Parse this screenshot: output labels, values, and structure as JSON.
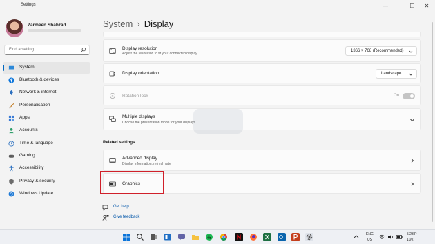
{
  "window": {
    "app_title": "Settings",
    "minimize": "—",
    "maximize": "☐",
    "close": "✕"
  },
  "user": {
    "name": "Zarmeen Shahzad"
  },
  "search": {
    "placeholder": "Find a setting"
  },
  "sidebar": {
    "items": [
      {
        "label": "System",
        "icon": "laptop-icon",
        "active": true
      },
      {
        "label": "Bluetooth & devices",
        "icon": "bluetooth-icon"
      },
      {
        "label": "Network & internet",
        "icon": "network-icon"
      },
      {
        "label": "Personalisation",
        "icon": "brush-icon"
      },
      {
        "label": "Apps",
        "icon": "apps-icon"
      },
      {
        "label": "Accounts",
        "icon": "person-icon"
      },
      {
        "label": "Time & language",
        "icon": "globe-clock-icon"
      },
      {
        "label": "Gaming",
        "icon": "gamepad-icon"
      },
      {
        "label": "Accessibility",
        "icon": "accessibility-icon"
      },
      {
        "label": "Privacy & security",
        "icon": "shield-icon"
      },
      {
        "label": "Windows Update",
        "icon": "update-icon"
      }
    ]
  },
  "breadcrumb": {
    "parent": "System",
    "separator": "›",
    "current": "Display"
  },
  "settings": {
    "resolution": {
      "title": "Display resolution",
      "subtitle": "Adjust the resolution to fit your connected display",
      "value": "1366 × 768 (Recommended)"
    },
    "orientation": {
      "title": "Display orientation",
      "value": "Landscape"
    },
    "rotation_lock": {
      "title": "Rotation lock",
      "state": "On"
    },
    "multiple_displays": {
      "title": "Multiple displays",
      "subtitle": "Choose the presentation mode for your displays"
    }
  },
  "related": {
    "heading": "Related settings",
    "advanced_display": {
      "title": "Advanced display",
      "subtitle": "Display information, refresh rate"
    },
    "graphics": {
      "title": "Graphics"
    }
  },
  "help": {
    "get_help": "Get help",
    "give_feedback": "Give feedback"
  },
  "tray": {
    "lang_top": "ENG",
    "lang_bottom": "US",
    "time": "5:23 P",
    "date": "10/7/"
  },
  "colors": {
    "accent": "#0067c0",
    "highlight_box": "#d0202a",
    "link": "#0055a8"
  }
}
